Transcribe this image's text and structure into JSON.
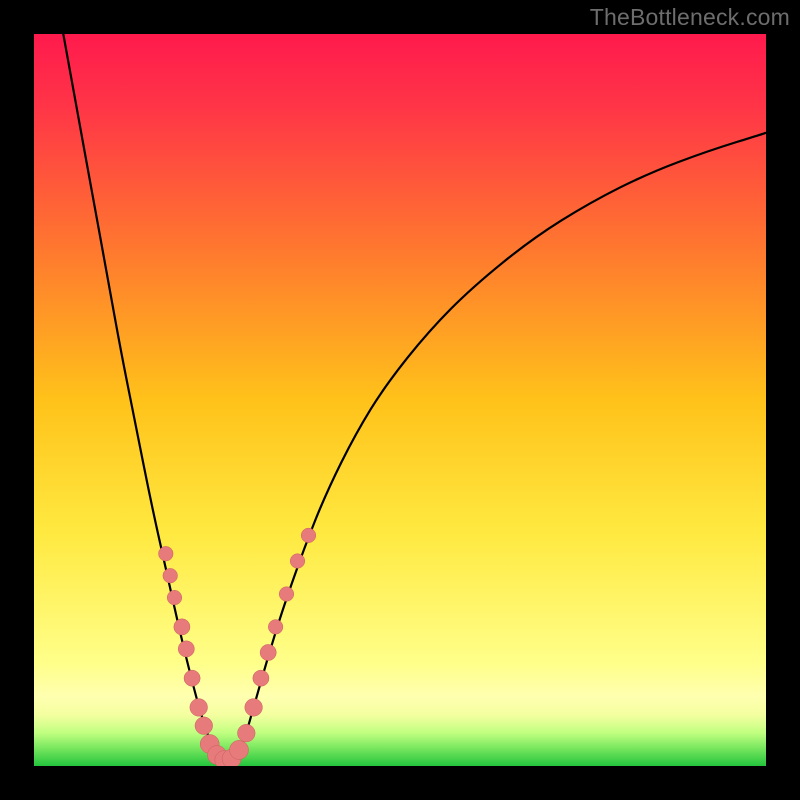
{
  "watermark": "TheBottleneck.com",
  "colors": {
    "frame": "#000000",
    "curve": "#000000",
    "dots_fill": "#e77a7a",
    "dots_stroke": "#c96060",
    "grad_stops": [
      {
        "offset": 0.0,
        "color": "#ff1a4d"
      },
      {
        "offset": 0.1,
        "color": "#ff3547"
      },
      {
        "offset": 0.3,
        "color": "#ff7a2e"
      },
      {
        "offset": 0.5,
        "color": "#ffc21a"
      },
      {
        "offset": 0.68,
        "color": "#ffeយ40"
      },
      {
        "offset": 0.68,
        "color": "#ffe940"
      },
      {
        "offset": 0.86,
        "color": "#ffff8a"
      },
      {
        "offset": 0.905,
        "color": "#ffffb0"
      },
      {
        "offset": 0.93,
        "color": "#f4ffa0"
      },
      {
        "offset": 0.955,
        "color": "#c0ff80"
      },
      {
        "offset": 0.975,
        "color": "#7be860"
      },
      {
        "offset": 1.0,
        "color": "#24c43d"
      }
    ]
  },
  "chart_data": {
    "type": "line",
    "title": "",
    "xlabel": "",
    "ylabel": "",
    "xlim": [
      0,
      100
    ],
    "ylim": [
      0,
      100
    ],
    "note": "Percent-of-area coordinates; y measured from top. Curve is a V-shaped bottleneck profile with minimum near x≈26.",
    "series": [
      {
        "name": "curve",
        "x": [
          4.0,
          6.0,
          8.0,
          10.0,
          12.0,
          14.0,
          16.0,
          18.0,
          20.0,
          22.0,
          23.0,
          24.0,
          25.0,
          26.0,
          27.0,
          28.0,
          29.0,
          30.0,
          32.0,
          34.0,
          37.0,
          40.0,
          44.0,
          48.0,
          54.0,
          60.0,
          68.0,
          76.0,
          84.0,
          92.0,
          100.0
        ],
        "y": [
          0.0,
          11.0,
          22.0,
          33.0,
          44.0,
          54.0,
          64.0,
          73.0,
          82.0,
          90.0,
          93.5,
          96.5,
          98.5,
          99.3,
          99.3,
          98.0,
          95.5,
          92.0,
          85.0,
          78.5,
          70.0,
          62.5,
          54.5,
          48.0,
          40.5,
          34.5,
          28.0,
          23.0,
          19.0,
          16.0,
          13.5
        ]
      }
    ],
    "dots": [
      {
        "x": 18.0,
        "y": 71.0,
        "r": 1.0
      },
      {
        "x": 18.6,
        "y": 74.0,
        "r": 1.0
      },
      {
        "x": 19.2,
        "y": 77.0,
        "r": 1.0
      },
      {
        "x": 20.2,
        "y": 81.0,
        "r": 1.1
      },
      {
        "x": 20.8,
        "y": 84.0,
        "r": 1.1
      },
      {
        "x": 21.6,
        "y": 88.0,
        "r": 1.1
      },
      {
        "x": 22.5,
        "y": 92.0,
        "r": 1.2
      },
      {
        "x": 23.2,
        "y": 94.5,
        "r": 1.2
      },
      {
        "x": 24.0,
        "y": 97.0,
        "r": 1.3
      },
      {
        "x": 25.0,
        "y": 98.5,
        "r": 1.3
      },
      {
        "x": 26.0,
        "y": 99.2,
        "r": 1.3
      },
      {
        "x": 27.0,
        "y": 99.0,
        "r": 1.3
      },
      {
        "x": 28.0,
        "y": 97.8,
        "r": 1.3
      },
      {
        "x": 29.0,
        "y": 95.5,
        "r": 1.2
      },
      {
        "x": 30.0,
        "y": 92.0,
        "r": 1.2
      },
      {
        "x": 31.0,
        "y": 88.0,
        "r": 1.1
      },
      {
        "x": 32.0,
        "y": 84.5,
        "r": 1.1
      },
      {
        "x": 33.0,
        "y": 81.0,
        "r": 1.0
      },
      {
        "x": 34.5,
        "y": 76.5,
        "r": 1.0
      },
      {
        "x": 36.0,
        "y": 72.0,
        "r": 1.0
      },
      {
        "x": 37.5,
        "y": 68.5,
        "r": 1.0
      }
    ]
  }
}
